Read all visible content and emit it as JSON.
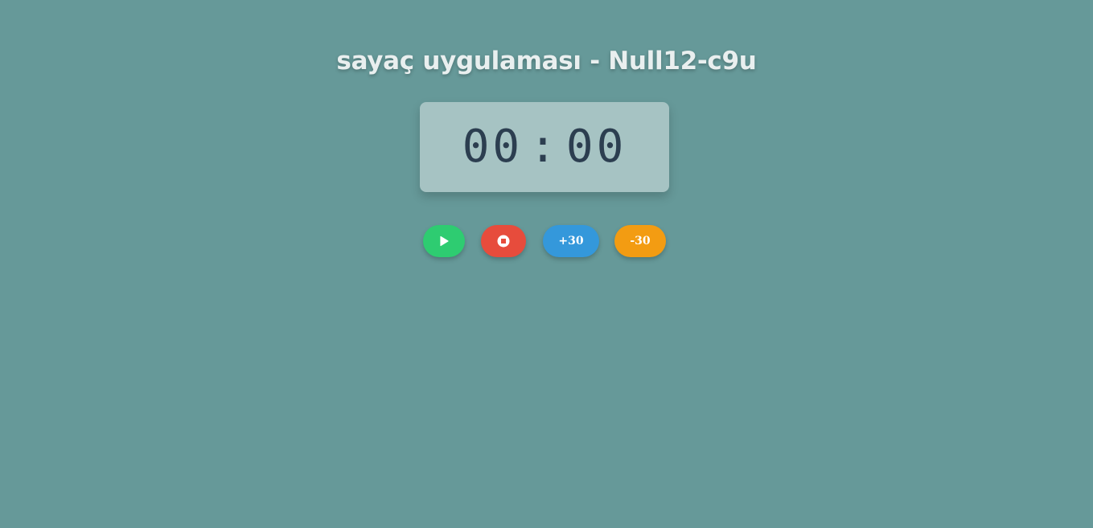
{
  "header": {
    "title": "sayaç uygulaması - Null12-c9u"
  },
  "timer": {
    "minutes": "00",
    "separator": ":",
    "seconds": "00"
  },
  "controls": {
    "start_icon": "play-icon",
    "stop_icon": "stop-icon",
    "plus_label": "+30",
    "minus_label": "-30"
  },
  "colors": {
    "background": "#669999",
    "display_bg": "#a6c3c3",
    "digits": "#2c3e50",
    "start": "#2ecc71",
    "stop": "#e74c3c",
    "plus": "#3498db",
    "minus": "#f39c12"
  }
}
